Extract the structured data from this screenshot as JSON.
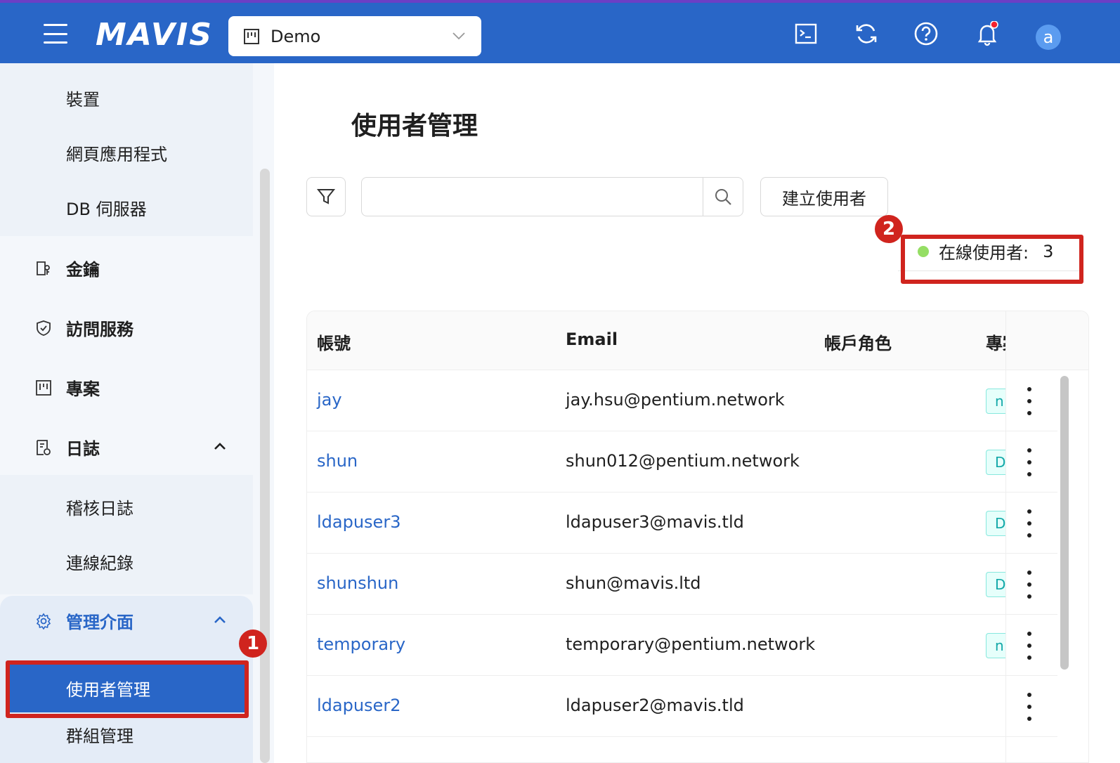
{
  "topbar": {
    "logo": "MAVIS",
    "project": "Demo",
    "icons": [
      "terminal-icon",
      "refresh-icon",
      "help-icon",
      "bell-icon"
    ],
    "avatar_letter": "a"
  },
  "sidebar": {
    "top_subitems": [
      "裝置",
      "網頁應用程式",
      "DB 伺服器"
    ],
    "items": [
      {
        "label": "金鑰",
        "icon": "key-icon"
      },
      {
        "label": "訪問服務",
        "icon": "shield-icon"
      },
      {
        "label": "專案",
        "icon": "project-icon"
      },
      {
        "label": "日誌",
        "icon": "log-icon"
      }
    ],
    "log_subitems": [
      "稽核日誌",
      "連線紀錄"
    ],
    "admin": {
      "label": "管理介面",
      "icon": "gear-icon"
    },
    "admin_subitems": [
      "使用者管理",
      "群組管理"
    ]
  },
  "annotations": {
    "one": "1",
    "two": "2"
  },
  "main": {
    "title": "使用者管理",
    "search_placeholder": "",
    "create_button": "建立使用者",
    "online_label": "在線使用者:",
    "online_count": "3"
  },
  "table": {
    "headers": [
      "帳號",
      "Email",
      "帳戶角色",
      "專案"
    ],
    "rows": [
      {
        "account": "jay",
        "email": "jay.hsu@pentium.network",
        "tag": "n"
      },
      {
        "account": "shun",
        "email": "shun012@pentium.network",
        "tag": "D"
      },
      {
        "account": "ldapuser3",
        "email": "ldapuser3@mavis.tld",
        "tag": "D"
      },
      {
        "account": "shunshun",
        "email": "shun@mavis.ltd",
        "tag": "D"
      },
      {
        "account": "temporary",
        "email": "temporary@pentium.network",
        "tag": "n"
      },
      {
        "account": "ldapuser2",
        "email": "ldapuser2@mavis.tld",
        "tag": ""
      }
    ]
  },
  "colors": {
    "brand": "#2966c7",
    "highlight": "#d0241e",
    "online": "#95de64"
  }
}
